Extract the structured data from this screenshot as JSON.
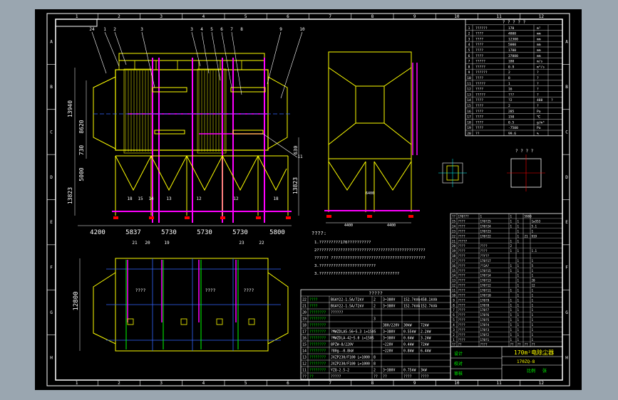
{
  "frame": {
    "top_cols": [
      "1",
      "2",
      "3",
      "4",
      "5",
      "6",
      "7",
      "8",
      "9",
      "10",
      "11",
      "12"
    ],
    "bottom_cols": [
      "1",
      "2",
      "3",
      "4",
      "5",
      "6",
      "7",
      "8",
      "9",
      "10",
      "11",
      "12"
    ],
    "rows": [
      "A",
      "B",
      "C",
      "D",
      "E",
      "F",
      "G",
      "H"
    ]
  },
  "elevation": {
    "dims_bottom": [
      "4200",
      "5837",
      "5730",
      "5730",
      "5730",
      "5800"
    ],
    "dims_left": [
      "13940",
      "8620",
      "730",
      "5000",
      "13823"
    ],
    "dims_right": [
      "630",
      "13823"
    ],
    "callouts_top": [
      "24",
      "1",
      "2",
      "3",
      "3",
      "4",
      "5",
      "6",
      "7",
      "8",
      "9",
      "10"
    ],
    "callouts_bottom": [
      "18",
      "15",
      "14",
      "13",
      "12",
      "12",
      "18"
    ],
    "callout_side": "11"
  },
  "side_view": {
    "dims": [
      "4400",
      "4400"
    ],
    "mid_label": "6400"
  },
  "plan": {
    "height_dim": "12800",
    "callouts": [
      "21",
      "20",
      "19",
      "23",
      "22"
    ],
    "labels": [
      "????",
      "????",
      "????"
    ]
  },
  "notes": {
    "title": "????:",
    "lines": [
      "1.?????????170??????????",
      "2??????????????????????????????????????????????",
      "   ?????? ????????????????????????????????????????",
      "3.????????????????????????",
      "3.??????????????????????????????????"
    ]
  },
  "spec_table": {
    "title": "? ? ? ? ?",
    "rows": [
      [
        "1",
        "??????",
        "170",
        "m²"
      ],
      [
        "2",
        "????",
        "4800",
        "mm"
      ],
      [
        "3",
        "????",
        "12300",
        "mm"
      ],
      [
        "4",
        "????",
        "5000",
        "mm"
      ],
      [
        "5",
        "????",
        "1700",
        "mm"
      ],
      [
        "6",
        "????",
        "37000",
        "mm"
      ],
      [
        "7",
        "?????",
        "180",
        "m/s"
      ],
      [
        "8",
        "?????",
        "0.9",
        "m³/s"
      ],
      [
        "9",
        "??????",
        "2",
        "?"
      ],
      [
        "10",
        "????",
        "8",
        "?"
      ],
      [
        "11",
        "?????",
        "1",
        "?"
      ],
      [
        "12",
        "????",
        "16",
        "?"
      ],
      [
        "13",
        "?????",
        "???",
        "?"
      ],
      [
        "14",
        "????",
        "?2",
        "460",
        "?"
      ],
      [
        "15",
        "????",
        "2",
        "?"
      ],
      [
        "16",
        "????",
        "285",
        "Pa"
      ],
      [
        "17",
        "????",
        "150",
        "℃"
      ],
      [
        "18",
        "????",
        "0.5",
        "g/m³"
      ],
      [
        "19",
        "????",
        "-7500",
        "Pa"
      ],
      [
        "20",
        "??",
        "99.6",
        "%"
      ]
    ]
  },
  "equip_table": {
    "title": "?????",
    "rows": [
      [
        "22",
        "????",
        "BGAY22-1.5A/72kV",
        "2",
        "3~380V",
        "152.7kVA",
        "458.1kVA"
      ],
      [
        "21",
        "????",
        "BGAY22-1.5A/72kV",
        "2",
        "3~380V",
        "152.7kVA",
        "152.7kVA"
      ],
      [
        "20",
        "????????",
        "??????",
        "",
        "",
        "",
        ""
      ],
      [
        "19",
        "????????",
        "",
        "3",
        "",
        "",
        ""
      ],
      [
        "18",
        "????????",
        "",
        "",
        "380/220V",
        "30kW",
        "72kW"
      ],
      [
        "17",
        "????????",
        "?MWZDLA5-56~5.3 i=1505",
        "",
        "3~380V",
        "0.55kW",
        "2.2kW"
      ],
      [
        "16",
        "????????",
        "?MWZDLA-42~5.0 i=1505",
        "",
        "3~380V",
        "0.6kW",
        "3.2kW"
      ],
      [
        "15",
        "????????",
        "8PZW-8/220V",
        "",
        "~220V",
        "0.4kW",
        "72kW"
      ],
      [
        "14",
        "????????",
        "?80g--0.8kW",
        "",
        "~220V",
        "0.8kW",
        "6.4kW"
      ],
      [
        "13",
        "????????",
        "JXZP230/F100 L=1000",
        "8",
        "",
        "",
        ""
      ],
      [
        "12",
        "????????",
        "JXZP230/F100 L=1000",
        "8",
        "",
        "",
        ""
      ],
      [
        "11",
        "????????",
        "YZQ-2.5-2",
        "2",
        "3~380V",
        "0.75kW",
        "3kW"
      ],
      [
        "??",
        "??",
        "?????",
        "??",
        "??",
        "????",
        "????"
      ]
    ]
  },
  "parts_table": {
    "rows": [
      [
        "?? ",
        "170???",
        "1",
        "1",
        "",
        "5980"
      ],
      [
        "25",
        "????",
        "170?25",
        "1",
        "1",
        "",
        "1w353"
      ],
      [
        "24",
        "????",
        "170?24",
        "1",
        "1",
        "",
        "5.1"
      ],
      [
        "23",
        "????",
        "170?23",
        "",
        "1",
        "",
        "1"
      ],
      [
        "22",
        "????",
        "170?22",
        "",
        "1",
        "21",
        "919"
      ],
      [
        "21",
        "?????",
        "",
        "1",
        "1",
        "",
        ""
      ],
      [
        "20",
        "????",
        "????",
        "2",
        "",
        "",
        ""
      ],
      [
        "19",
        "????",
        "????",
        "1",
        "1",
        "",
        "1.1"
      ],
      [
        "18",
        "????",
        "??Y??",
        "",
        "",
        "",
        ""
      ],
      [
        "17",
        "????",
        "170?17",
        "",
        "1",
        "",
        "1"
      ],
      [
        "16",
        "????",
        "??2A?",
        "1",
        "1",
        "",
        "5"
      ],
      [
        "15",
        "????",
        "170?15",
        "1",
        "1",
        "",
        "1"
      ],
      [
        "14",
        "????",
        "170?14",
        "",
        "1",
        "",
        "1"
      ],
      [
        "13",
        "????",
        "170?13",
        "",
        "1",
        "",
        "20"
      ],
      [
        "12",
        "????",
        "170?12",
        "",
        "1",
        "",
        "12"
      ],
      [
        "11",
        "????",
        "170?11",
        "1",
        "1",
        "",
        "1"
      ],
      [
        "10",
        "????",
        "170?10",
        "",
        "1",
        "",
        "1"
      ],
      [
        "9",
        "????",
        "170?9",
        "1",
        "1",
        "",
        "1"
      ],
      [
        "8",
        "????",
        "170?8",
        "1",
        "1",
        "",
        "1"
      ],
      [
        "7",
        "????",
        "170?7",
        "1",
        "1",
        "",
        "1"
      ],
      [
        "6",
        "????",
        "170?6",
        "1",
        "1",
        "",
        "1"
      ],
      [
        "5",
        "????",
        "170?5",
        "1",
        "1",
        "",
        "1"
      ],
      [
        "4",
        "????",
        "170?4",
        "1",
        "1",
        "",
        "1"
      ],
      [
        "3",
        "????",
        "170?3",
        "1",
        "1",
        "",
        "1"
      ],
      [
        "2",
        "????",
        "170?2",
        "1",
        "1",
        "",
        "1"
      ],
      [
        "1",
        "????",
        "170?1",
        "1",
        "1",
        "",
        "1"
      ],
      [
        "??",
        "??",
        "????",
        "??",
        "??",
        "??",
        "??"
      ]
    ]
  },
  "title_block": {
    "drawing_title": "170m²电除尘器",
    "drawing_no": "170ZQ-8",
    "scale_label": "比例",
    "sheet_label": "张",
    "left_labels": [
      "设计",
      "校对",
      "审核"
    ]
  },
  "detail_label": "? ? ? ?",
  "colors": {
    "frame": "#ffffff",
    "structure": "#ffff00",
    "pink": "#ff00ff",
    "blue": "#0000ff",
    "green": "#00ff00",
    "red": "#ff0000",
    "cyan": "#00ffff",
    "text": "#ffffff"
  }
}
